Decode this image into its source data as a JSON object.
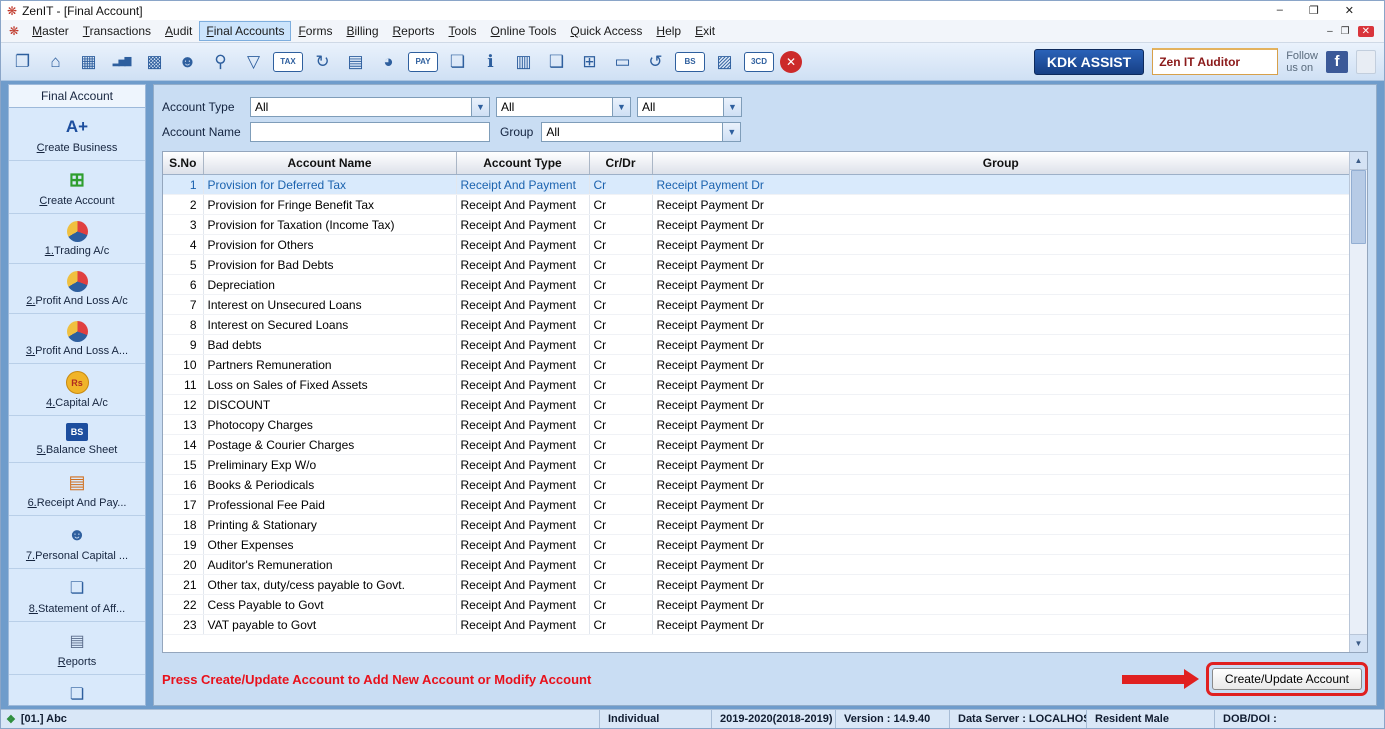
{
  "colors": {
    "accent_blue": "#2e5f9e",
    "kdk_blue": "#1d4e9e",
    "selected_row_bg": "#d9eafc",
    "selected_row_text": "#1b62ae",
    "annotation_red": "#e02020",
    "instruction_red": "#e8111b"
  },
  "window": {
    "icon_glyph": "❋",
    "title": "ZenIT - [Final Account]",
    "controls": [
      {
        "name": "minimize-button",
        "glyph": "–"
      },
      {
        "name": "maximize-button",
        "glyph": "❐"
      },
      {
        "name": "close-button",
        "glyph": "✕"
      }
    ]
  },
  "menu": {
    "icon_glyph": "❋",
    "items": [
      "Master",
      "Transactions",
      "Audit",
      "Final Accounts",
      "Forms",
      "Billing",
      "Reports",
      "Tools",
      "Online Tools",
      "Quick Access",
      "Help",
      "Exit"
    ],
    "active": "Final Accounts",
    "mdi_controls": [
      {
        "name": "mdi-minimize-button",
        "glyph": "–"
      },
      {
        "name": "mdi-restore-button",
        "glyph": "❐"
      },
      {
        "name": "mdi-close-button",
        "glyph": "✕",
        "danger": true
      }
    ]
  },
  "toolbar": {
    "icons": [
      {
        "name": "window-restore-icon",
        "glyph": "❐"
      },
      {
        "name": "home-icon",
        "glyph": "⌂"
      },
      {
        "name": "company-master-icon",
        "glyph": "▦"
      },
      {
        "name": "bar-chart-icon",
        "glyph": "▂▅▇",
        "small": true
      },
      {
        "name": "gift-icon",
        "glyph": "▩"
      },
      {
        "name": "clients-group-icon",
        "glyph": "☻"
      },
      {
        "name": "search-icon",
        "glyph": "⚲"
      },
      {
        "name": "filter-icon",
        "glyph": "▽"
      },
      {
        "name": "tax-badge-icon",
        "glyph": "TAX",
        "badge": true
      },
      {
        "name": "refresh-icon",
        "glyph": "↻"
      },
      {
        "name": "calculator-icon",
        "glyph": "▤"
      },
      {
        "name": "pie-chart-icon",
        "glyph": "◕"
      },
      {
        "name": "e-pay-icon",
        "glyph": "PAY",
        "badge": true
      },
      {
        "name": "document-icon",
        "glyph": "❏"
      },
      {
        "name": "info-icon",
        "glyph": "ℹ"
      },
      {
        "name": "abacus-icon",
        "glyph": "▥"
      },
      {
        "name": "export-document-icon",
        "glyph": "❑"
      },
      {
        "name": "calendar-icon",
        "glyph": "⊞"
      },
      {
        "name": "computer-monitor-icon",
        "glyph": "▭"
      },
      {
        "name": "import-icon",
        "glyph": "↺"
      },
      {
        "name": "bs-badge-icon",
        "glyph": "BS",
        "badge": true
      },
      {
        "name": "bank-icon",
        "glyph": "▨"
      },
      {
        "name": "3cd-badge-icon",
        "glyph": "3CD",
        "badge": true
      },
      {
        "name": "close-red-icon",
        "glyph": "✕",
        "danger": true
      }
    ],
    "kdk_assist_label": "KDK ASSIST",
    "auditor_label": "Zen IT Auditor",
    "follow_line1": "Follow",
    "follow_line2": "us on",
    "facebook_glyph": "f"
  },
  "sidebar": {
    "title": "Final Account",
    "items": [
      {
        "id": "create-business",
        "label": "Create Business",
        "glyph": "A+",
        "icon_name": "create-business-icon",
        "style": "ic-a"
      },
      {
        "id": "create-account",
        "label": "Create Account",
        "glyph": "⊞",
        "icon_name": "create-account-icon",
        "style": "ic-green"
      },
      {
        "id": "trading-ac",
        "label": "1.Trading A/c",
        "glyph": "",
        "icon_name": "trading-pie-icon",
        "style": "ic-pie"
      },
      {
        "id": "profit-and-loss-ac",
        "label": "2.Profit And Loss A/c",
        "glyph": "",
        "icon_name": "profit-loss-pie-icon",
        "style": "ic-pie"
      },
      {
        "id": "profit-and-loss-a2",
        "label": "3.Profit And Loss A...",
        "glyph": "",
        "icon_name": "profit-loss-pie-icon",
        "style": "ic-pie"
      },
      {
        "id": "capital-ac",
        "label": "4.Capital A/c",
        "glyph": "Rs",
        "icon_name": "rupee-coin-icon",
        "style": "ic-coin"
      },
      {
        "id": "balance-sheet",
        "label": "5.Balance Sheet",
        "glyph": "BS",
        "icon_name": "balance-sheet-icon",
        "style": "ic-bs"
      },
      {
        "id": "receipt-and-pay",
        "label": "6.Receipt And Pay...",
        "glyph": "▤",
        "icon_name": "receipt-payment-icon",
        "style": "ic-orange"
      },
      {
        "id": "personal-capital",
        "label": "7.Personal Capital ...",
        "glyph": "☻",
        "icon_name": "person-icon",
        "style": "ic-person"
      },
      {
        "id": "statement-of-affairs",
        "label": "8.Statement of Aff...",
        "glyph": "❏",
        "icon_name": "statement-icon",
        "style": "ic-doc"
      },
      {
        "id": "reports",
        "label": "Reports",
        "glyph": "▤",
        "icon_name": "reports-icon",
        "style": "ic-report"
      },
      {
        "id": "extra",
        "label": "",
        "glyph": "❏",
        "icon_name": "document-icon",
        "style": "ic-doc"
      }
    ]
  },
  "filters": {
    "account_type_label": "Account Type",
    "account_name_label": "Account Name",
    "group_label": "Group",
    "account_type_value": "All",
    "account_type2_value": "All",
    "account_type3_value": "All",
    "account_name_value": "",
    "group_value": "All",
    "dropdown_glyph": "▼"
  },
  "table": {
    "headers": [
      "S.No",
      "Account Name",
      "Account Type",
      "Cr/Dr",
      "Group"
    ],
    "scroll_up_glyph": "▲",
    "scroll_down_glyph": "▼",
    "rows": [
      {
        "sno": "1",
        "name": "Provision for Deferred Tax",
        "type": "Receipt And Payment",
        "crdr": "Cr",
        "group": "Receipt Payment Dr"
      },
      {
        "sno": "2",
        "name": "Provision for Fringe Benefit Tax",
        "type": "Receipt And Payment",
        "crdr": "Cr",
        "group": "Receipt Payment Dr"
      },
      {
        "sno": "3",
        "name": "Provision for Taxation (Income Tax)",
        "type": "Receipt And Payment",
        "crdr": "Cr",
        "group": "Receipt Payment Dr"
      },
      {
        "sno": "4",
        "name": "Provision for Others",
        "type": "Receipt And Payment",
        "crdr": "Cr",
        "group": "Receipt Payment Dr"
      },
      {
        "sno": "5",
        "name": "Provision for Bad Debts",
        "type": "Receipt And Payment",
        "crdr": "Cr",
        "group": "Receipt Payment Dr"
      },
      {
        "sno": "6",
        "name": "Depreciation",
        "type": "Receipt And Payment",
        "crdr": "Cr",
        "group": "Receipt Payment Dr"
      },
      {
        "sno": "7",
        "name": "Interest on Unsecured Loans",
        "type": "Receipt And Payment",
        "crdr": "Cr",
        "group": "Receipt Payment Dr"
      },
      {
        "sno": "8",
        "name": "Interest on Secured Loans",
        "type": "Receipt And Payment",
        "crdr": "Cr",
        "group": "Receipt Payment Dr"
      },
      {
        "sno": "9",
        "name": "Bad debts",
        "type": "Receipt And Payment",
        "crdr": "Cr",
        "group": "Receipt Payment Dr"
      },
      {
        "sno": "10",
        "name": "Partners Remuneration",
        "type": "Receipt And Payment",
        "crdr": "Cr",
        "group": "Receipt Payment Dr"
      },
      {
        "sno": "11",
        "name": "Loss on Sales of Fixed Assets",
        "type": "Receipt And Payment",
        "crdr": "Cr",
        "group": "Receipt Payment Dr"
      },
      {
        "sno": "12",
        "name": "DISCOUNT",
        "type": "Receipt And Payment",
        "crdr": "Cr",
        "group": "Receipt Payment Dr"
      },
      {
        "sno": "13",
        "name": "Photocopy Charges",
        "type": "Receipt And Payment",
        "crdr": "Cr",
        "group": "Receipt Payment Dr"
      },
      {
        "sno": "14",
        "name": "Postage & Courier Charges",
        "type": "Receipt And Payment",
        "crdr": "Cr",
        "group": "Receipt Payment Dr"
      },
      {
        "sno": "15",
        "name": "Preliminary Exp W/o",
        "type": "Receipt And Payment",
        "crdr": "Cr",
        "group": "Receipt Payment Dr"
      },
      {
        "sno": "16",
        "name": "Books & Periodicals",
        "type": "Receipt And Payment",
        "crdr": "Cr",
        "group": "Receipt Payment Dr"
      },
      {
        "sno": "17",
        "name": "Professional Fee Paid",
        "type": "Receipt And Payment",
        "crdr": "Cr",
        "group": "Receipt Payment Dr"
      },
      {
        "sno": "18",
        "name": "Printing & Stationary",
        "type": "Receipt And Payment",
        "crdr": "Cr",
        "group": "Receipt Payment Dr"
      },
      {
        "sno": "19",
        "name": "Other Expenses",
        "type": "Receipt And Payment",
        "crdr": "Cr",
        "group": "Receipt Payment Dr"
      },
      {
        "sno": "20",
        "name": "Auditor's Remuneration",
        "type": "Receipt And Payment",
        "crdr": "Cr",
        "group": "Receipt Payment Dr"
      },
      {
        "sno": "21",
        "name": "Other tax, duty/cess payable to Govt.",
        "type": "Receipt And Payment",
        "crdr": "Cr",
        "group": "Receipt Payment Dr"
      },
      {
        "sno": "22",
        "name": "Cess Payable to Govt",
        "type": "Receipt And Payment",
        "crdr": "Cr",
        "group": "Receipt Payment Dr"
      },
      {
        "sno": "23",
        "name": "VAT payable to Govt",
        "type": "Receipt And Payment",
        "crdr": "Cr",
        "group": "Receipt Payment Dr"
      }
    ]
  },
  "footer": {
    "instruction": "Press Create/Update Account to Add New Account or Modify Account",
    "button_label": "Create/Update Account"
  },
  "statusbar": {
    "icon_glyph": "❖",
    "client": "[01.] Abc",
    "fields": [
      "Individual",
      "2019-2020(2018-2019)",
      "Version : 14.9.40",
      "Data Server : LOCALHOST",
      "Resident Male",
      "DOB/DOI :"
    ]
  }
}
